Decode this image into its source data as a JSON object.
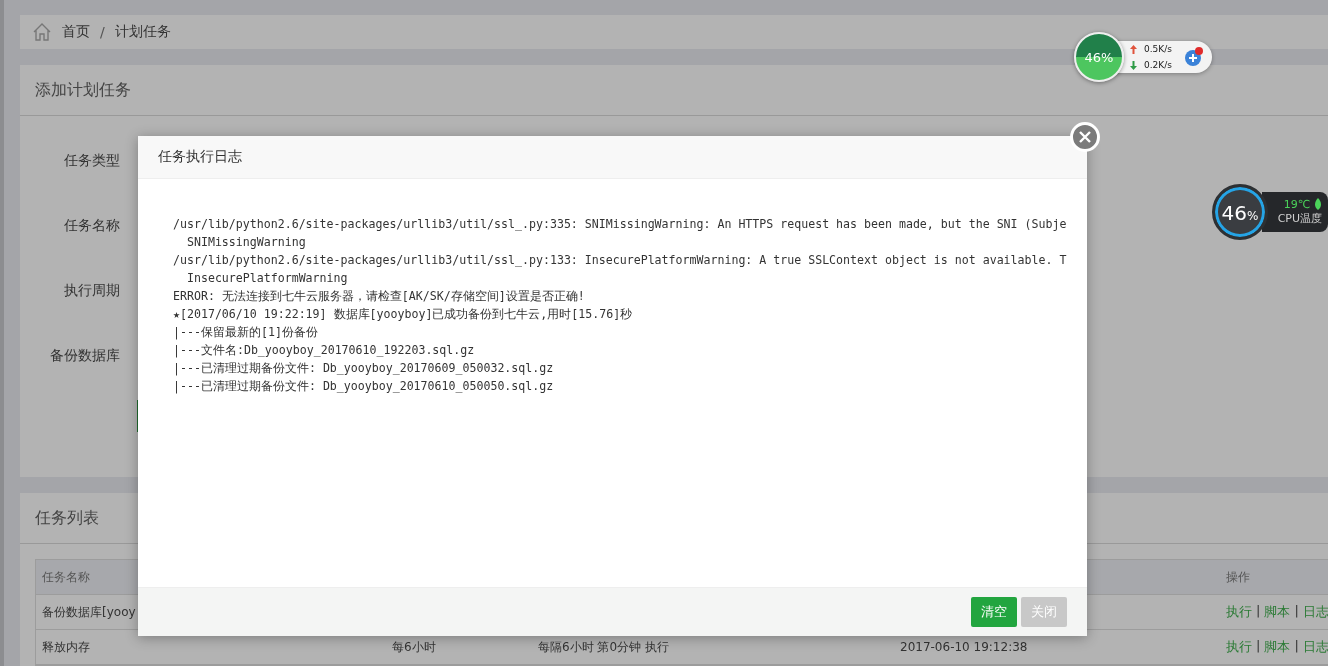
{
  "breadcrumb": {
    "items": [
      "首页",
      "计划任务"
    ],
    "separator": "/"
  },
  "add_panel": {
    "title": "添加计划任务",
    "fields": [
      "任务类型",
      "任务名称",
      "执行周期",
      "备份数据库"
    ]
  },
  "task_panel": {
    "title": "任务列表",
    "separator": "|",
    "columns": [
      {
        "label": "任务名称"
      },
      {
        "label": "操作"
      }
    ],
    "rows": [
      {
        "cells": [
          "备份数据库[yooy",
          "",
          "",
          ""
        ],
        "actions": [
          "执行",
          "脚本",
          "日志"
        ]
      },
      {
        "cells": [
          "释放内存",
          "每6小时",
          "每隔6小时 第0分钟 执行",
          "2017-06-10 19:12:38"
        ],
        "actions": [
          "执行",
          "脚本",
          "日志"
        ]
      }
    ]
  },
  "modal": {
    "title": "任务执行日志",
    "lines": [
      "/usr/lib/python2.6/site-packages/urllib3/util/ssl_.py:335: SNIMissingWarning: An HTTPS request has been made, but the SNI (Subje",
      "  SNIMissingWarning",
      "/usr/lib/python2.6/site-packages/urllib3/util/ssl_.py:133: InsecurePlatformWarning: A true SSLContext object is not available. T",
      "  InsecurePlatformWarning",
      "ERROR: 无法连接到七牛云服务器，请检查[AK/SK/存储空间]设置是否正确!",
      "★[2017/06/10 19:22:19] 数据库[yooyboy]已成功备份到七牛云,用时[15.76]秒",
      "|---保留最新的[1]份备份",
      "|---文件名:Db_yooyboy_20170610_192203.sql.gz",
      "|---已清理过期备份文件: Db_yooyboy_20170609_050032.sql.gz",
      "|---已清理过期备份文件: Db_yooyboy_20170610_050050.sql.gz"
    ],
    "buttons": [
      {
        "label": "清空",
        "disabled": false
      },
      {
        "label": "关闭",
        "disabled": true
      }
    ]
  },
  "net_widget": {
    "percent": "46%",
    "up": "0.5K/s",
    "down": "0.2K/s"
  },
  "cpu_widget": {
    "percent": "46",
    "unit": "%",
    "temperature": "19℃",
    "label": "CPU温度"
  }
}
